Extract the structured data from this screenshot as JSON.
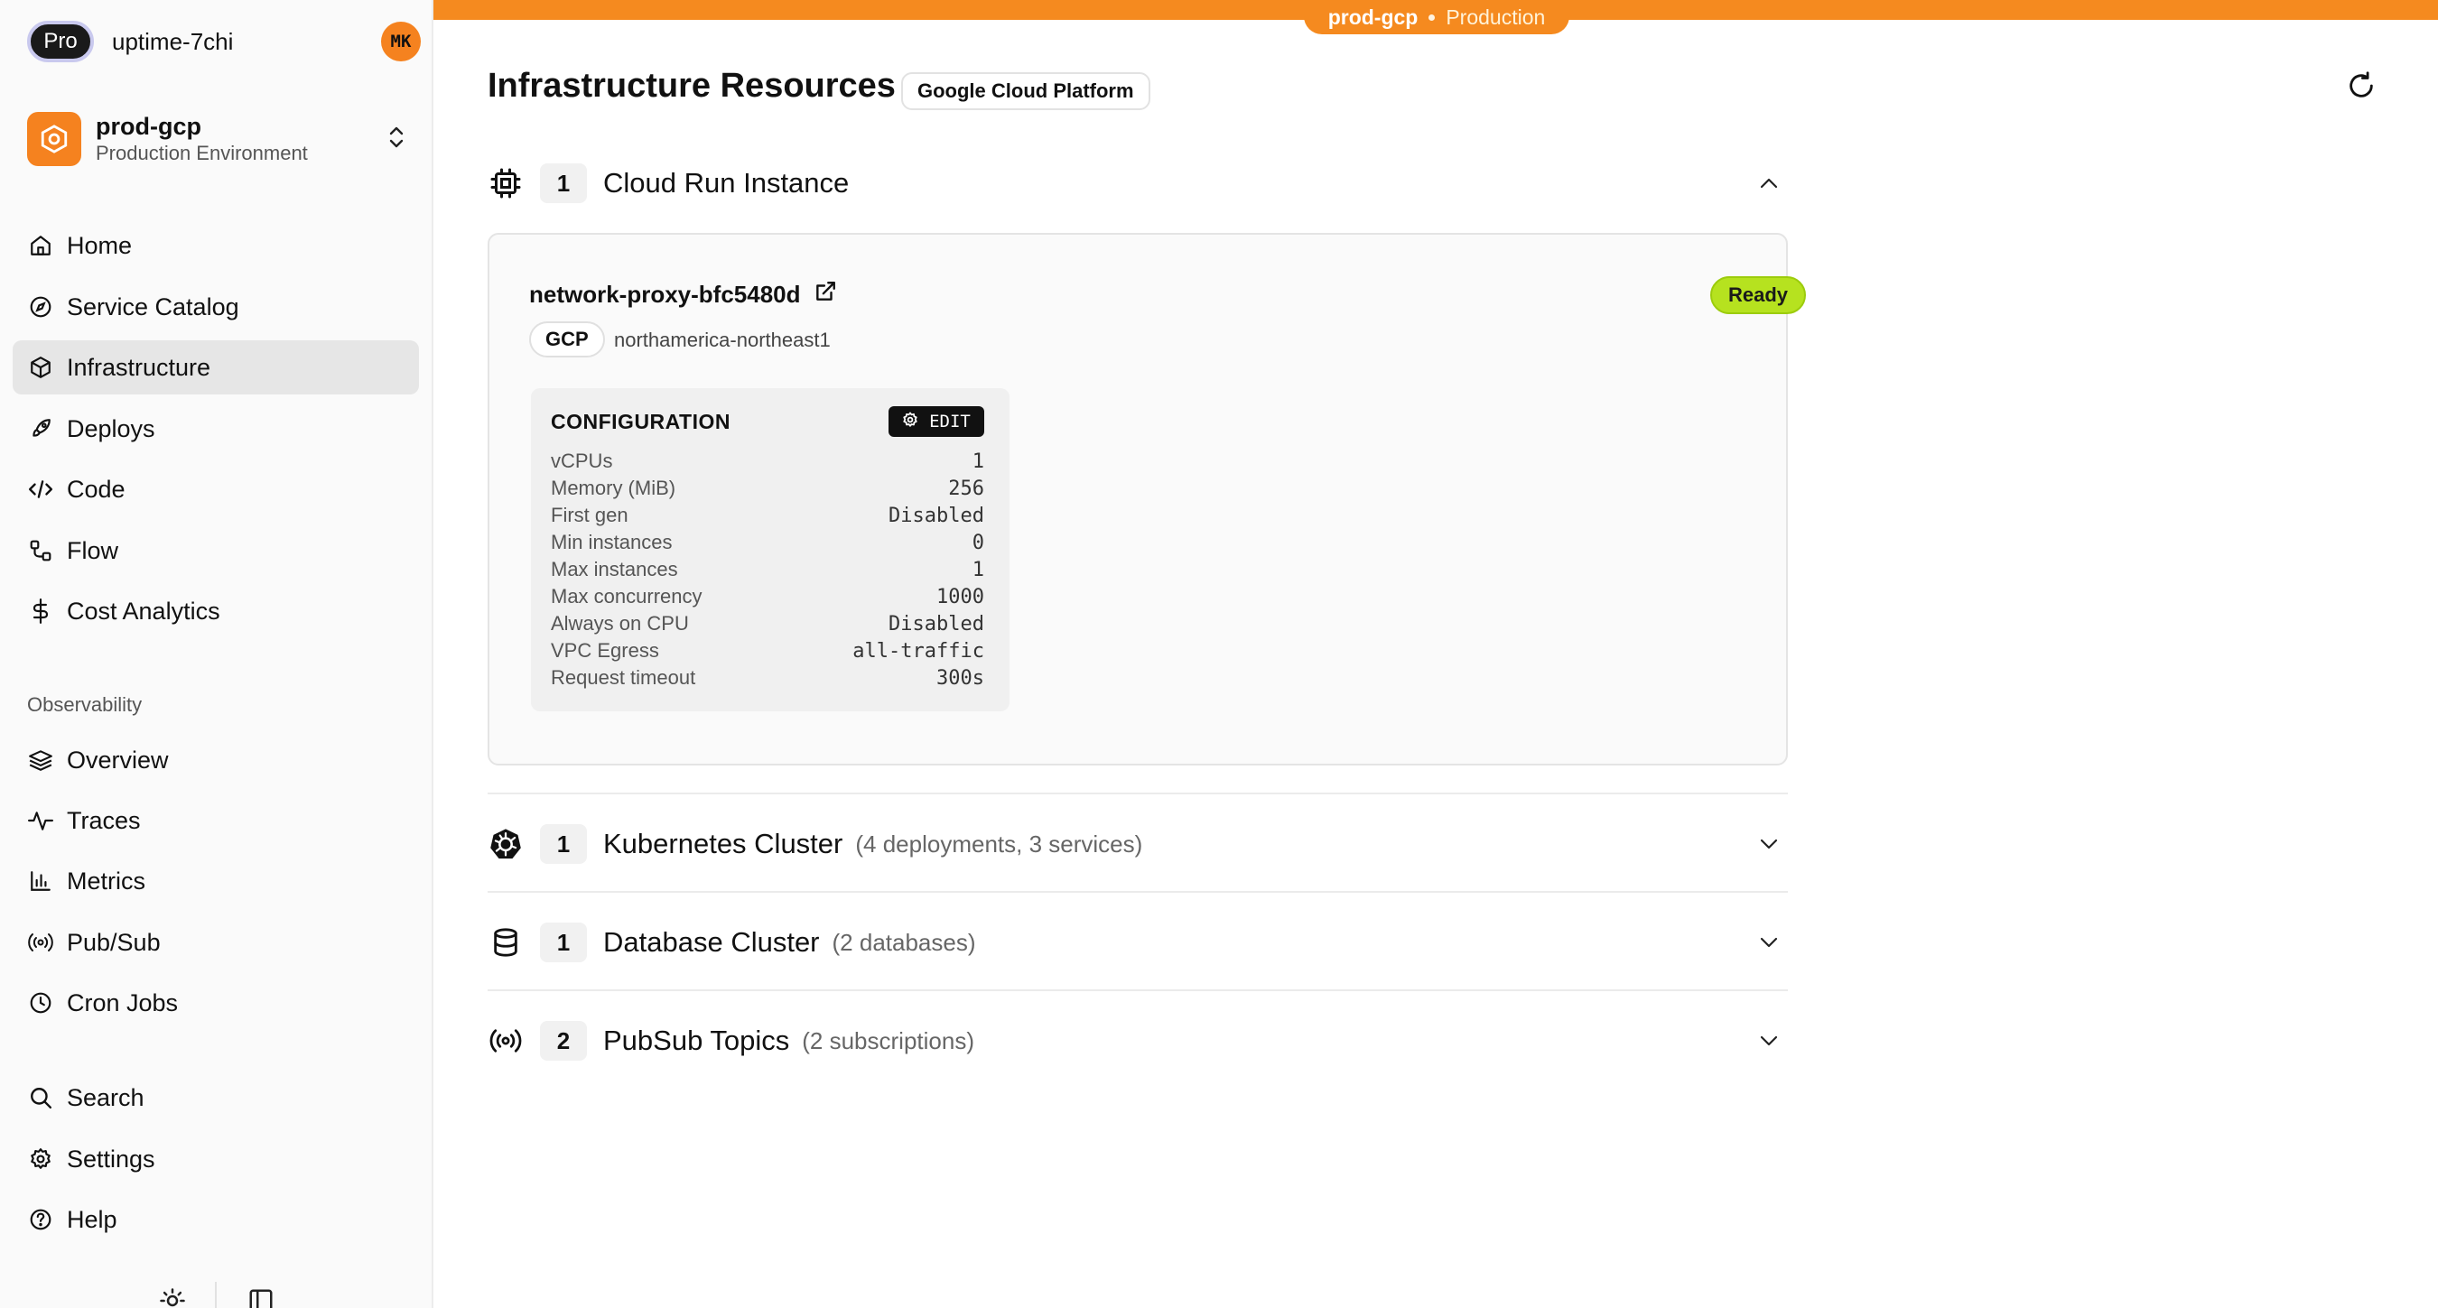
{
  "sidebar": {
    "plan_badge": "Pro",
    "workspace": "uptime-7chi",
    "avatar_initials": "MK",
    "environment": {
      "name": "prod-gcp",
      "subtitle": "Production Environment"
    },
    "nav_primary": [
      {
        "label": "Home",
        "icon": "home-icon"
      },
      {
        "label": "Service Catalog",
        "icon": "compass-icon"
      },
      {
        "label": "Infrastructure",
        "icon": "cube-icon",
        "active": true
      },
      {
        "label": "Deploys",
        "icon": "rocket-icon"
      },
      {
        "label": "Code",
        "icon": "code-icon"
      },
      {
        "label": "Flow",
        "icon": "flow-icon"
      },
      {
        "label": "Cost Analytics",
        "icon": "dollar-icon"
      }
    ],
    "observability_label": "Observability",
    "nav_observability": [
      {
        "label": "Overview",
        "icon": "layers-icon"
      },
      {
        "label": "Traces",
        "icon": "activity-icon"
      },
      {
        "label": "Metrics",
        "icon": "bar-chart-icon"
      },
      {
        "label": "Pub/Sub",
        "icon": "broadcast-icon"
      },
      {
        "label": "Cron Jobs",
        "icon": "clock-icon"
      }
    ],
    "nav_bottom": [
      {
        "label": "Search",
        "icon": "search-icon"
      },
      {
        "label": "Settings",
        "icon": "gear-icon"
      },
      {
        "label": "Help",
        "icon": "help-icon"
      }
    ]
  },
  "env_banner": {
    "name": "prod-gcp",
    "type": "Production",
    "color": "#f58a1f"
  },
  "page": {
    "title": "Infrastructure Resources",
    "provider": "Google Cloud Platform"
  },
  "groups": [
    {
      "count": "1",
      "title": "Cloud Run Instance",
      "subtitle": "",
      "icon": "cpu-chip-icon",
      "expanded": true
    },
    {
      "count": "1",
      "title": "Kubernetes Cluster",
      "subtitle": "(4 deployments, 3 services)",
      "icon": "kubernetes-icon",
      "expanded": false
    },
    {
      "count": "1",
      "title": "Database Cluster",
      "subtitle": "(2 databases)",
      "icon": "database-icon",
      "expanded": false
    },
    {
      "count": "2",
      "title": "PubSub Topics",
      "subtitle": "(2 subscriptions)",
      "icon": "broadcast-icon",
      "expanded": false
    }
  ],
  "cloud_run": {
    "service_name": "network-proxy-bfc5480d",
    "status": "Ready",
    "status_color": "#b6e21f",
    "cloud": "GCP",
    "region": "northamerica-northeast1",
    "config_title": "CONFIGURATION",
    "edit_label": "EDIT",
    "config": [
      {
        "key": "vCPUs",
        "value": "1"
      },
      {
        "key": "Memory (MiB)",
        "value": "256"
      },
      {
        "key": "First gen",
        "value": "Disabled"
      },
      {
        "key": "Min instances",
        "value": "0"
      },
      {
        "key": "Max instances",
        "value": "1"
      },
      {
        "key": "Max concurrency",
        "value": "1000"
      },
      {
        "key": "Always on CPU",
        "value": "Disabled"
      },
      {
        "key": "VPC Egress",
        "value": "all-traffic"
      },
      {
        "key": "Request timeout",
        "value": "300s"
      }
    ]
  }
}
